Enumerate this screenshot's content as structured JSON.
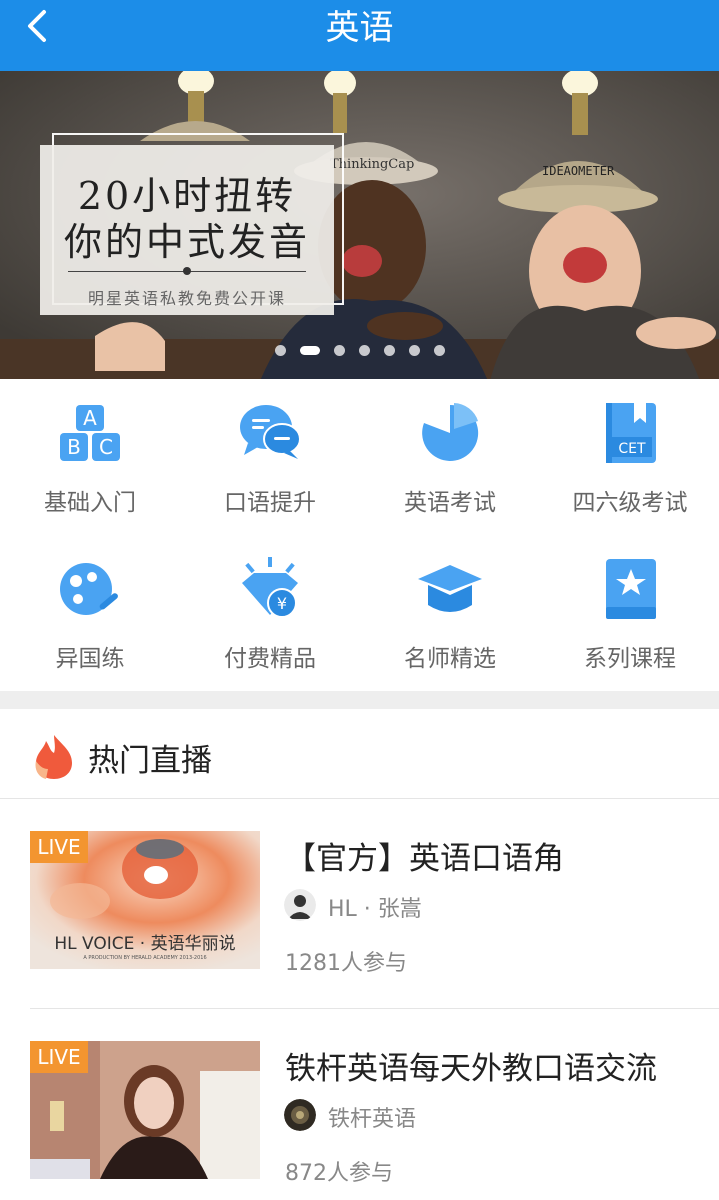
{
  "header": {
    "title": "英语",
    "back_icon": "chevron-left-icon"
  },
  "banner": {
    "line1": "20小时扭转",
    "line2": "你的中式发音",
    "subtitle": "明星英语私教免费公开课",
    "hat_left": "ThinkingCap",
    "hat_right": "IDEAOMETER",
    "slide_count": 7,
    "active_slide": 2
  },
  "categories": [
    {
      "label": "基础入门",
      "icon": "abc-blocks-icon"
    },
    {
      "label": "口语提升",
      "icon": "chat-bubbles-icon"
    },
    {
      "label": "英语考试",
      "icon": "pie-chart-icon"
    },
    {
      "label": "四六级考试",
      "icon": "cet-book-icon",
      "icon_text": "CET"
    },
    {
      "label": "异国练",
      "icon": "film-reel-icon"
    },
    {
      "label": "付费精品",
      "icon": "diamond-coin-icon"
    },
    {
      "label": "名师精选",
      "icon": "graduation-cap-icon"
    },
    {
      "label": "系列课程",
      "icon": "star-book-icon"
    }
  ],
  "section": {
    "title": "热门直播",
    "icon": "fire-icon"
  },
  "live_items": [
    {
      "badge": "LIVE",
      "thumb_caption": "HL VOICE · 英语华丽说",
      "thumb_fine_print": "A PRODUCTION BY HERALD ACADEMY 2013-2016",
      "title": "【官方】英语口语角",
      "author": "HL · 张嵩",
      "participants": "1281人参与"
    },
    {
      "badge": "LIVE",
      "title": "铁杆英语每天外教口语交流",
      "author": "铁杆英语",
      "participants": "872人参与"
    }
  ],
  "colors": {
    "primary": "#1c8de8",
    "icon_blue": "#4aa3f2",
    "live_badge": "#f39530",
    "fire": "#f05a3c"
  }
}
